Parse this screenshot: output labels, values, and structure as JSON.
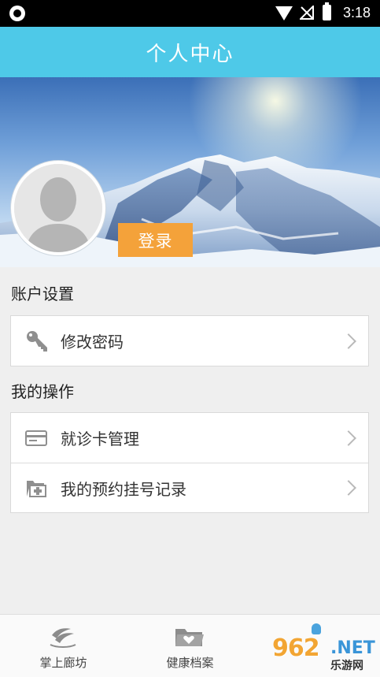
{
  "status_bar": {
    "time": "3:18",
    "icons": [
      "sync-icon",
      "wifi-icon",
      "no-signal-icon",
      "battery-charging-icon"
    ]
  },
  "header": {
    "title": "个人中心"
  },
  "profile": {
    "avatar_icon": "default-avatar-icon",
    "login_label": "登录",
    "login_color": "#f4a23a"
  },
  "account_settings": {
    "title": "账户设置",
    "items": [
      {
        "label": "修改密码",
        "icon": "key-icon"
      }
    ]
  },
  "my_operations": {
    "title": "我的操作",
    "items": [
      {
        "label": "就诊卡管理",
        "icon": "card-icon"
      },
      {
        "label": "我的预约挂号记录",
        "icon": "folder-add-icon"
      }
    ]
  },
  "bottom_nav": {
    "items": [
      {
        "label": "掌上廊坊",
        "icon": "langfang-logo-icon"
      },
      {
        "label": "健康档案",
        "icon": "health-folder-icon"
      },
      {
        "label": "",
        "icon": "person-icon"
      }
    ]
  },
  "watermark": {
    "number": "962",
    "domain": ".NET",
    "text": "乐游网"
  },
  "colors": {
    "accent": "#4ec9e8",
    "login": "#f4a23a",
    "background": "#efefef"
  }
}
